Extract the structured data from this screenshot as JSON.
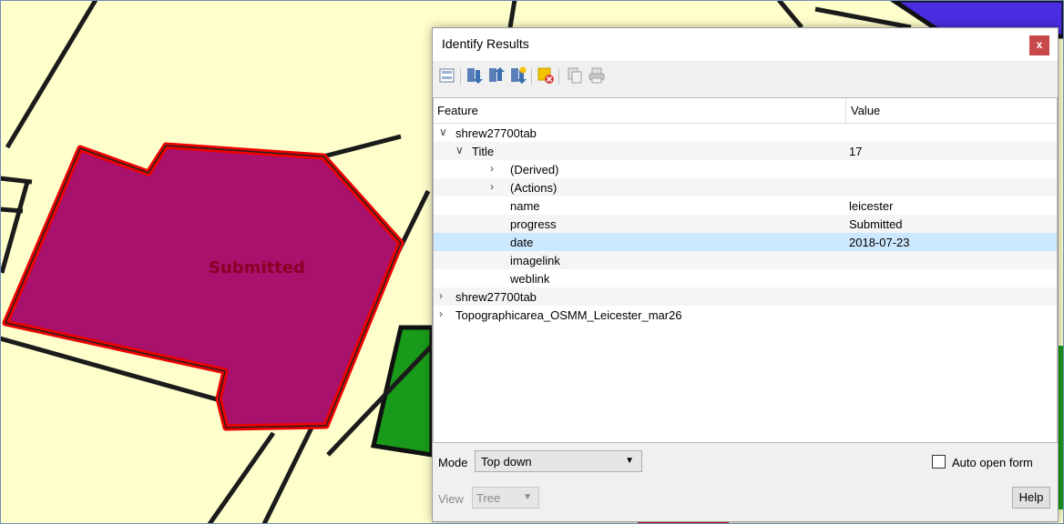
{
  "map": {
    "polygon_label": "Submitted",
    "colors": {
      "background": "#ffffcc",
      "selected_fill": "#a8116c",
      "selected_outline": "#ee0000",
      "label": "#8b0026",
      "green_feature": "#1a9a1a",
      "blue_feature": "#4a2de0"
    }
  },
  "dialog": {
    "title": "Identify Results",
    "close_label": "x",
    "toolbar_icons": [
      "expand-tree-icon",
      "expand-all-icon",
      "collapse-all-icon",
      "expand-new-icon",
      "clear-highlight-icon",
      "copy-icon",
      "print-icon"
    ],
    "columns": {
      "feature": "Feature",
      "value": "Value"
    },
    "rows": [
      {
        "label": "shrew27700tab",
        "value": "",
        "expanded": true
      },
      {
        "label": "Title",
        "value": "17",
        "expanded": true
      },
      {
        "label": "(Derived)",
        "value": "",
        "expanded": false
      },
      {
        "label": "(Actions)",
        "value": "",
        "expanded": false
      },
      {
        "label": "name",
        "value": "leicester"
      },
      {
        "label": "progress",
        "value": "Submitted"
      },
      {
        "label": "date",
        "value": "2018-07-23",
        "selected": true
      },
      {
        "label": "imagelink",
        "value": ""
      },
      {
        "label": "weblink",
        "value": ""
      },
      {
        "label": "shrew27700tab",
        "value": "",
        "expanded": false
      },
      {
        "label": "Topographicarea_OSMM_Leicester_mar26",
        "value": "",
        "expanded": false
      }
    ],
    "mode_label": "Mode",
    "mode_value": "Top down",
    "auto_open_label": "Auto open form",
    "auto_open_checked": false,
    "view_label": "View",
    "view_value": "Tree",
    "help_label": "Help"
  }
}
